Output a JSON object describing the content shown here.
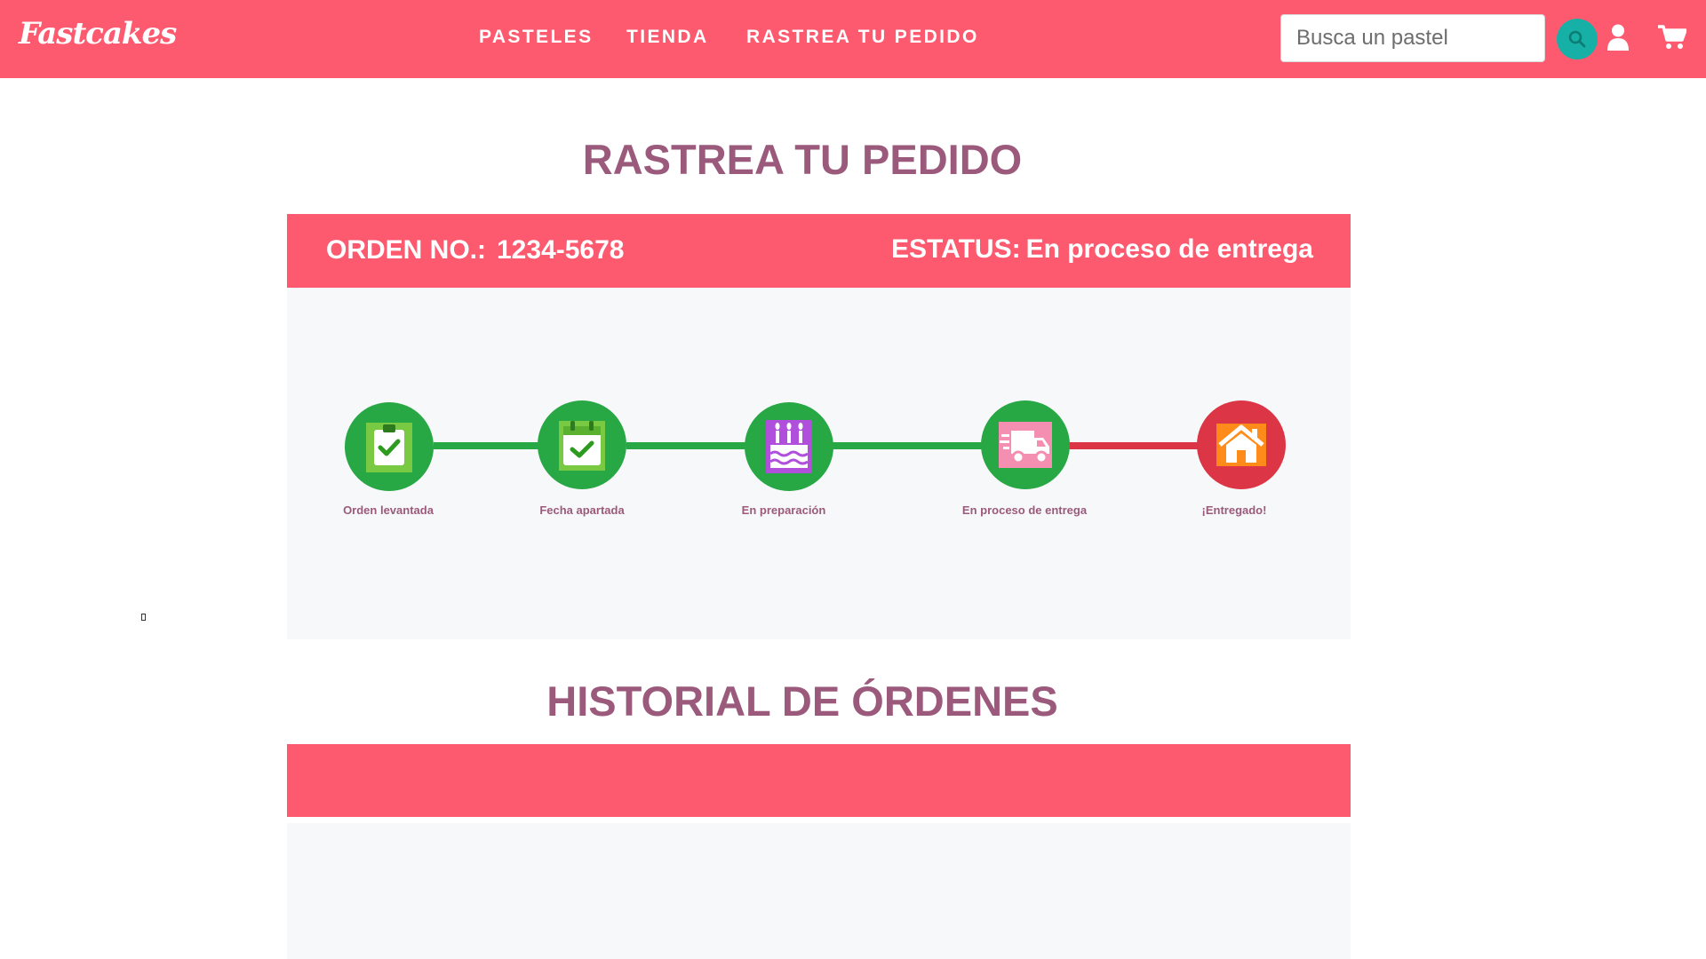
{
  "navbar": {
    "logo": "Fastcakes",
    "links": [
      "PASTELES",
      "TIENDA",
      "RASTREA TU PEDIDO"
    ],
    "search_placeholder": "Busca un pastel",
    "icons": [
      "search-icon",
      "user-icon",
      "cart-icon"
    ]
  },
  "tracking": {
    "title": "RASTREA TU PEDIDO",
    "order_label": "ORDEN NO.:",
    "order_number": "1234-5678",
    "status_label": "ESTATUS:",
    "status_value": "En proceso de entrega",
    "steps": [
      {
        "label": "Orden levantada",
        "icon": "clipboard-check-icon",
        "state": "complete"
      },
      {
        "label": "Fecha apartada",
        "icon": "calendar-check-icon",
        "state": "complete"
      },
      {
        "label": "En preparación",
        "icon": "birthday-cake-icon",
        "state": "complete"
      },
      {
        "label": "En proceso de entrega",
        "icon": "delivery-truck-icon",
        "state": "complete"
      },
      {
        "label": "¡Entregado!",
        "icon": "house-icon",
        "state": "pending"
      }
    ]
  },
  "history": {
    "title": "HISTORIAL DE ÓRDENES"
  },
  "colors": {
    "brand": "#fe5a6f",
    "heading": "#9b5a7c",
    "complete": "#28a745",
    "pending": "#dc3545",
    "search_button": "#16b0a6",
    "panel": "#f7f8fa"
  }
}
